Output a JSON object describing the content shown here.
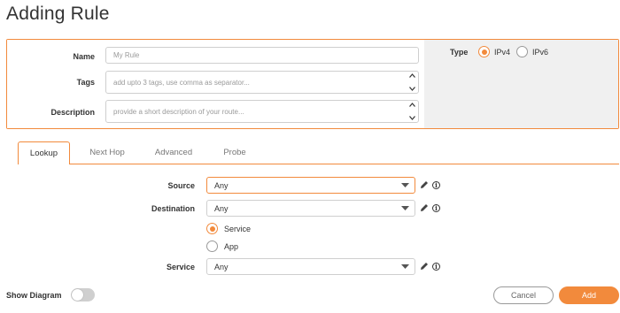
{
  "page": {
    "title": "Adding Rule"
  },
  "form": {
    "name": {
      "label": "Name",
      "placeholder": "My Rule"
    },
    "tags": {
      "label": "Tags",
      "placeholder": "add upto 3 tags, use comma as separator..."
    },
    "description": {
      "label": "Description",
      "placeholder": "provide a short description of your route..."
    },
    "type": {
      "label": "Type",
      "options": [
        "IPv4",
        "IPv6"
      ],
      "selected": "IPv4"
    }
  },
  "tabs": [
    {
      "label": "Lookup",
      "active": true
    },
    {
      "label": "Next Hop",
      "active": false
    },
    {
      "label": "Advanced",
      "active": false
    },
    {
      "label": "Probe",
      "active": false
    }
  ],
  "lookup": {
    "source": {
      "label": "Source",
      "value": "Any"
    },
    "destination": {
      "label": "Destination",
      "value": "Any"
    },
    "service_type": {
      "options": [
        "Service",
        "App"
      ],
      "selected": "Service"
    },
    "service": {
      "label": "Service",
      "value": "Any"
    }
  },
  "footer": {
    "show_diagram_label": "Show Diagram",
    "show_diagram_on": false,
    "cancel_label": "Cancel",
    "add_label": "Add"
  },
  "icons": {
    "edit": "pencil-icon",
    "info": "info-icon",
    "caret": "caret-down-icon"
  },
  "colors": {
    "accent": "#f28a3c",
    "panel_gray": "#f0f0f0",
    "border": "#cfcfcf"
  }
}
